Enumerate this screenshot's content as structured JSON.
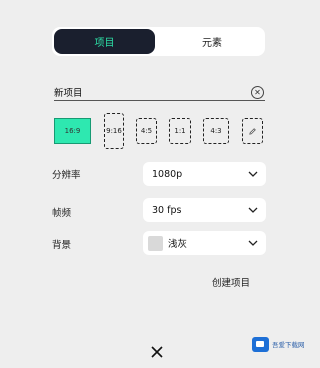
{
  "tabs": {
    "active": "项目",
    "inactive": "元素"
  },
  "name_field": {
    "value": "新项目"
  },
  "ratios": [
    {
      "label": "16:9",
      "selected": true
    },
    {
      "label": "9:16"
    },
    {
      "label": "4:5"
    },
    {
      "label": "1:1"
    },
    {
      "label": "4:3"
    }
  ],
  "settings": {
    "resolution": {
      "label": "分辨率",
      "value": "1080p"
    },
    "framerate": {
      "label": "帧频",
      "value": "30 fps"
    },
    "background": {
      "label": "背景",
      "value": "浅灰",
      "swatch_color": "#d9d9d9"
    }
  },
  "create_label": "创建项目",
  "watermark": "吾爱下载网",
  "colors": {
    "accent": "#2ee8b0",
    "active_tab_bg": "#1a1f2e",
    "panel_bg": "#eeeeee"
  }
}
